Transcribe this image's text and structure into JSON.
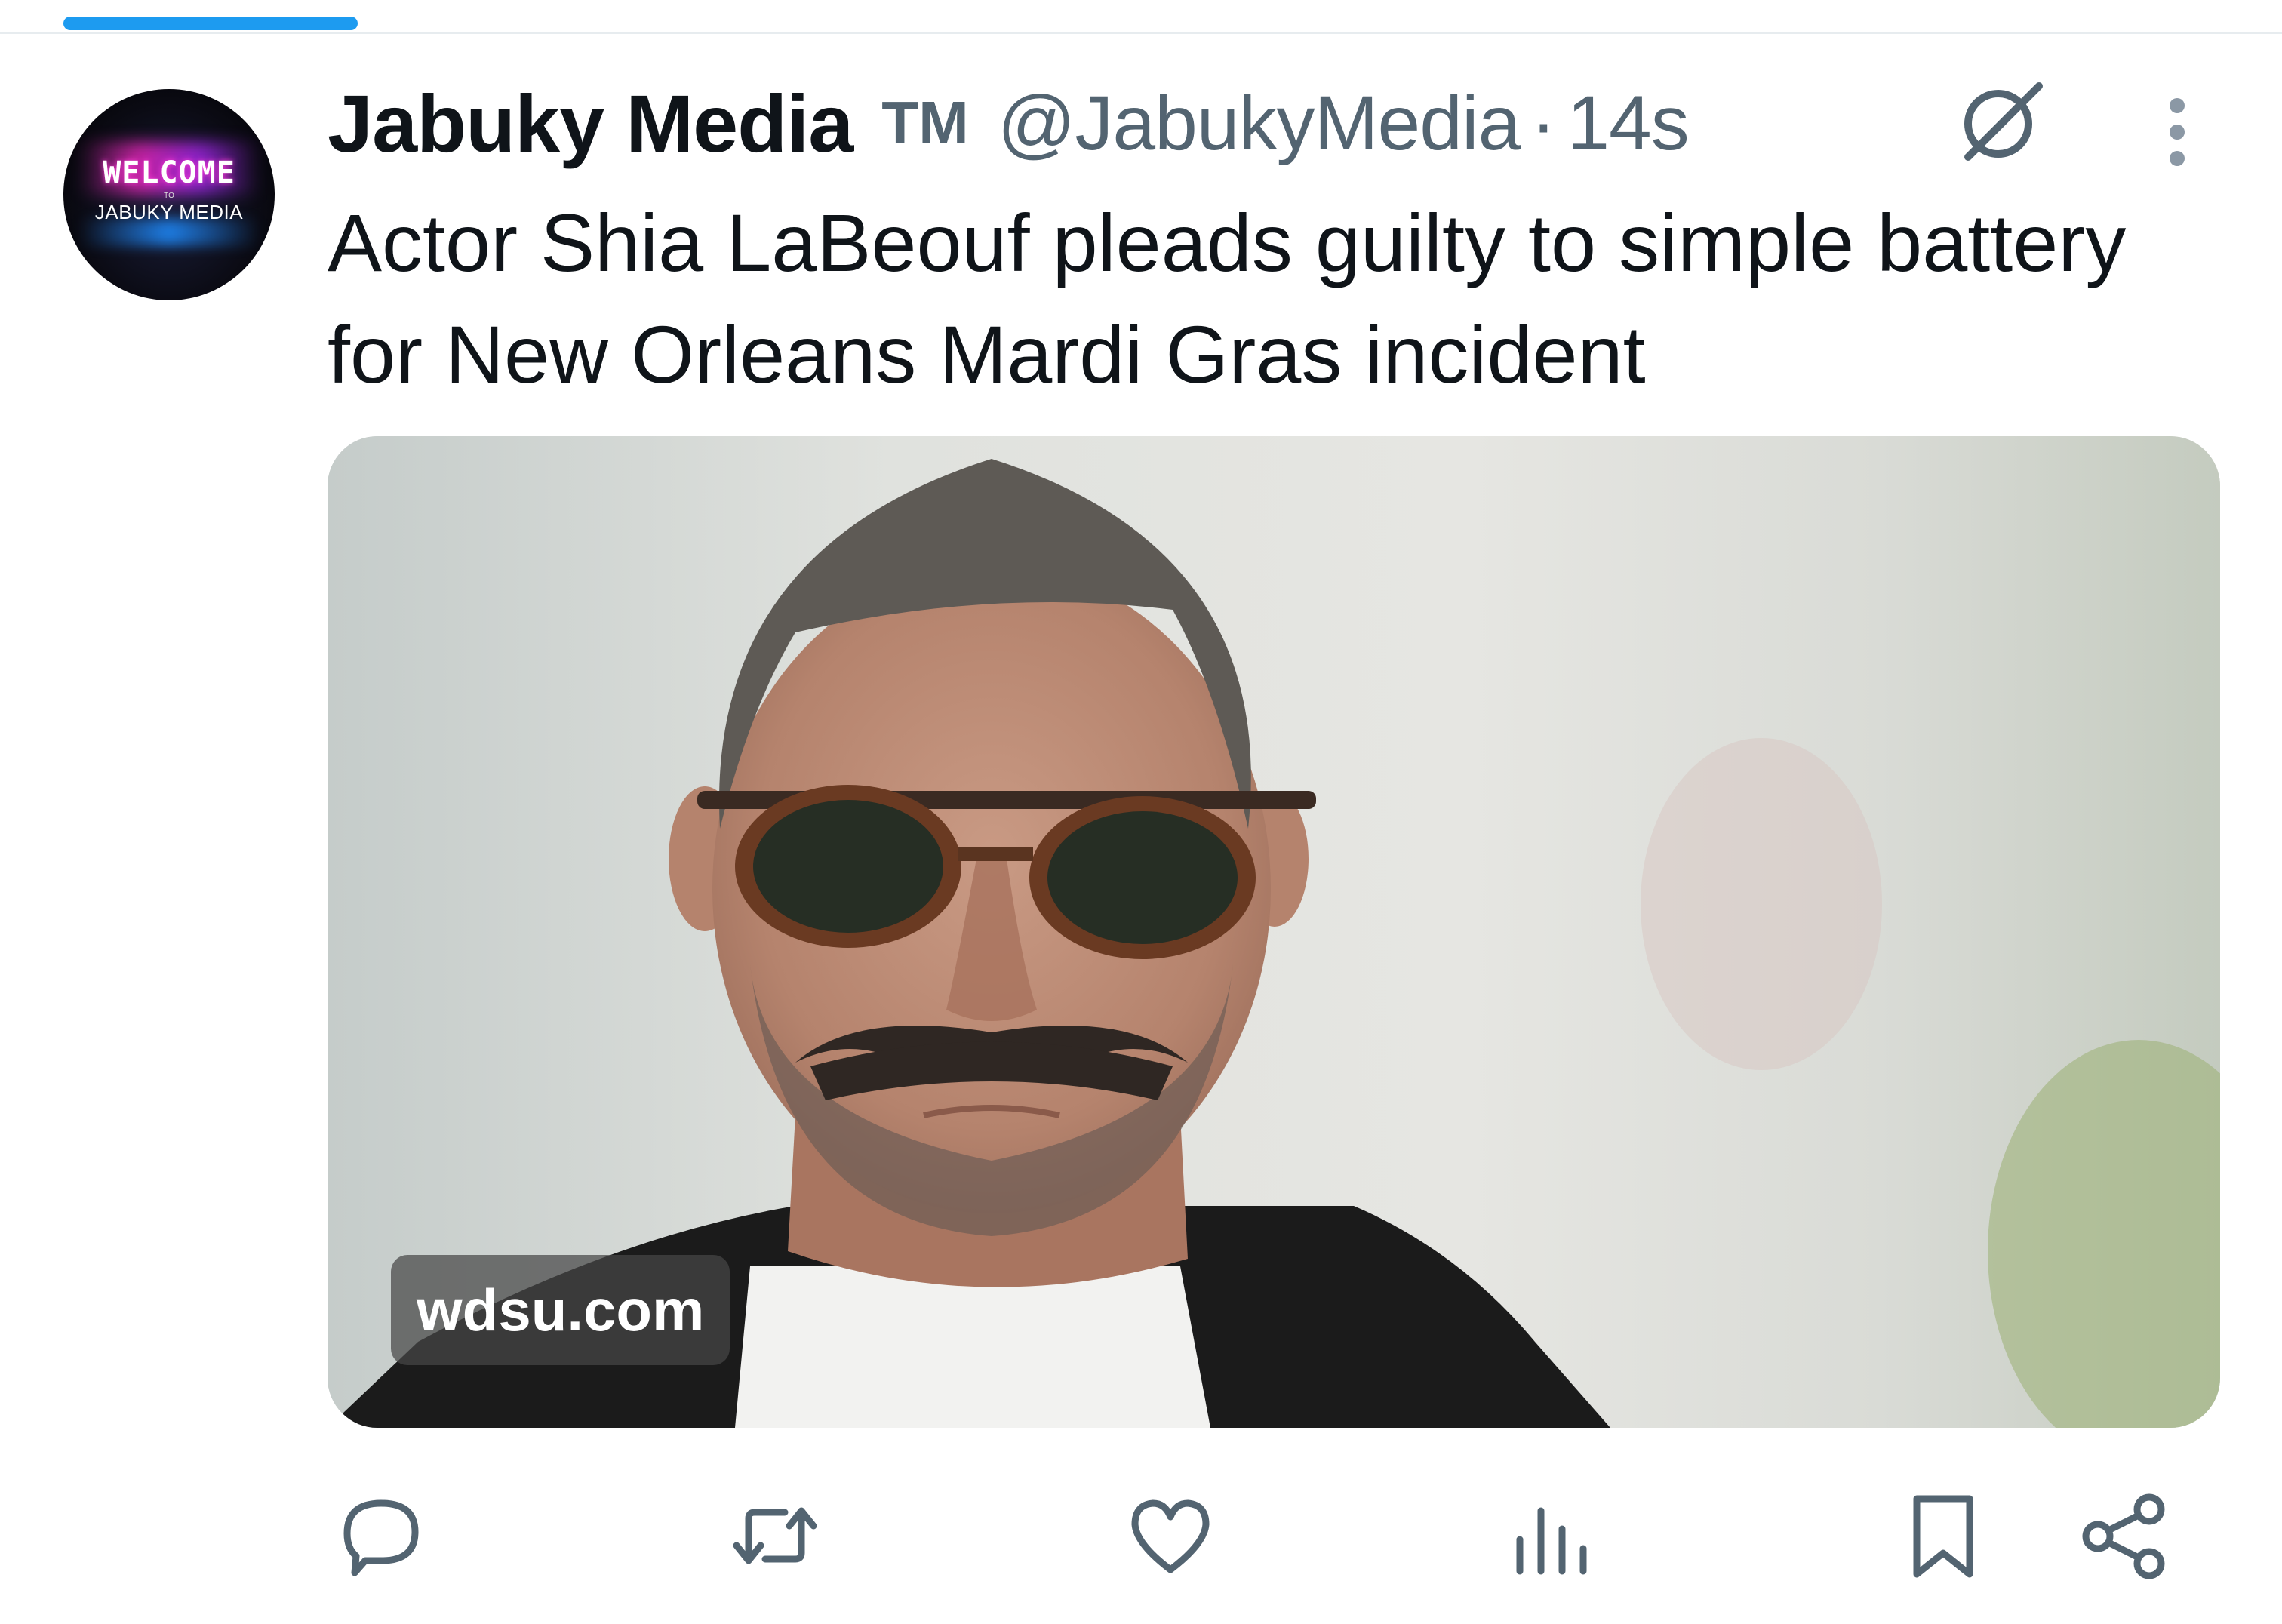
{
  "tweet": {
    "author_name": "Jabuky Media",
    "badge": "TM",
    "handle": "@JabukyMedia",
    "separator": "·",
    "time": "14s",
    "text": "Actor Shia LaBeouf pleads guilty to simple battery for New Orleans Mardi Gras incident"
  },
  "avatar": {
    "welcome": "WELCOME",
    "to": "TO",
    "brand": "JABUKY MEDIA"
  },
  "media": {
    "source": "wdsu.com"
  },
  "icons": {
    "grok": "grok-icon",
    "more": "more-vertical-icon",
    "reply": "reply-icon",
    "retweet": "retweet-icon",
    "like": "heart-icon",
    "views": "views-icon",
    "bookmark": "bookmark-icon",
    "share": "share-icon"
  },
  "colors": {
    "accent": "#1d9bf0",
    "text": "#0f1419",
    "muted": "#536471"
  }
}
